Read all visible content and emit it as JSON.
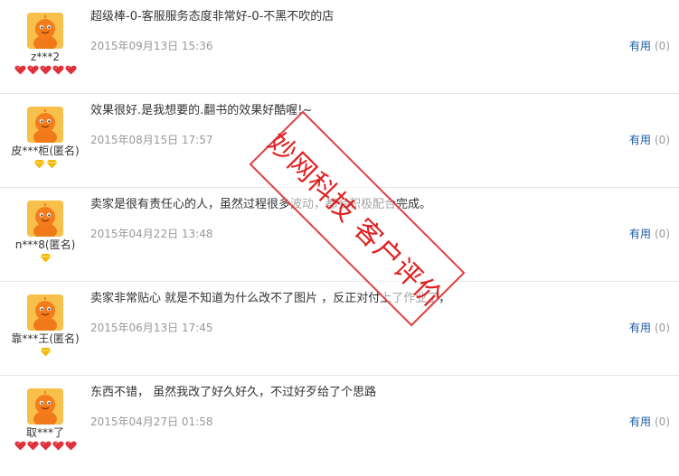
{
  "reviews": [
    {
      "user": "z***2",
      "level": {
        "type": "heart",
        "count": 5
      },
      "content": "超级棒-0-客服服务态度非常好-0-不黑不吹的店",
      "date": "2015年09月13日  15:36",
      "useful_label": "有用",
      "useful_count": "(0)"
    },
    {
      "user": "皮***柜(匿名)",
      "level": {
        "type": "diamond",
        "count": 2
      },
      "content": "效果很好.是我想要的.翻书的效果好酷喔!~",
      "date": "2015年08月15日  17:57",
      "useful_label": "有用",
      "useful_count": "(0)"
    },
    {
      "user": "n***8(匿名)",
      "level": {
        "type": "diamond",
        "count": 1
      },
      "content": "卖家是很有责任心的人，虽然过程很多波动，都会积极配合完成。",
      "date": "2015年04月22日  13:48",
      "useful_label": "有用",
      "useful_count": "(0)"
    },
    {
      "user": "靠***王(匿名)",
      "level": {
        "type": "diamond",
        "count": 1
      },
      "content": "卖家非常贴心 就是不知道为什么改不了图片 ，反正对付上了作业了，",
      "date": "2015年06月13日  17:45",
      "useful_label": "有用",
      "useful_count": "(0)"
    },
    {
      "user": "取***了",
      "level": {
        "type": "heart",
        "count": 5
      },
      "content": "东西不错， 虽然我改了好久好久，不过好歹给了个思路",
      "date": "2015年04月27日  01:58",
      "useful_label": "有用",
      "useful_count": "(0)"
    }
  ],
  "watermark": "妙网科技 客户评价",
  "colors": {
    "link": "#1c5aa3",
    "muted": "#999999",
    "stamp": "#e02020",
    "heart": "#e0303a",
    "diamond": "#f2b800",
    "avatar": "#f5b83a"
  },
  "icons": {
    "avatar": "orange-mascot-avatar-icon",
    "heart": "red-heart-level-icon",
    "diamond": "yellow-diamond-level-icon"
  }
}
